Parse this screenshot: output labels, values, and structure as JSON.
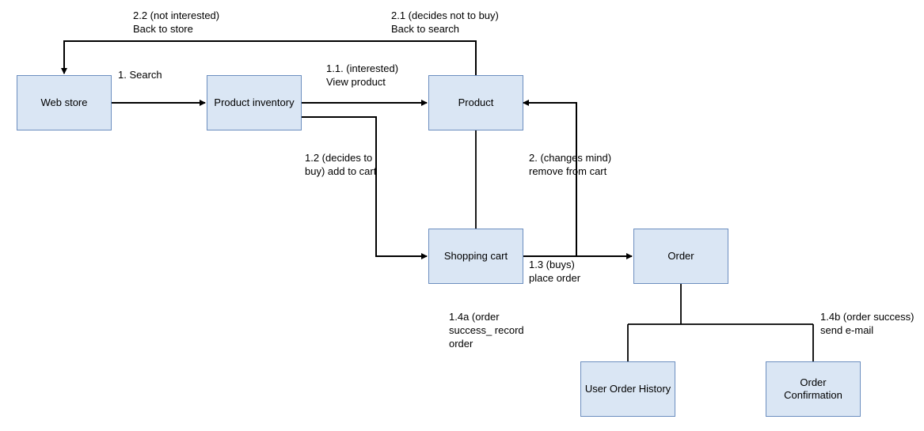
{
  "nodes": {
    "web_store": {
      "label": "Web store"
    },
    "product_inventory": {
      "label": "Product\ninventory"
    },
    "product": {
      "label": "Product"
    },
    "shopping_cart": {
      "label": "Shopping cart"
    },
    "order": {
      "label": "Order"
    },
    "user_order_history": {
      "label": "User Order\nHistory"
    },
    "order_confirmation": {
      "label": "Order\nConfirmation"
    }
  },
  "edges": {
    "search": {
      "label": "1. Search"
    },
    "view_product": {
      "label": "1.1. (interested)\nView product"
    },
    "add_to_cart": {
      "label": "1.2 (decides to\nbuy) add to cart"
    },
    "place_order": {
      "label": "1.3 (buys)\nplace order"
    },
    "record_order": {
      "label": "1.4a (order\nsuccess_ record\norder"
    },
    "send_email": {
      "label": "1.4b (order success)\nsend e-mail"
    },
    "remove_cart": {
      "label": "2. (changes mind)\nremove from cart"
    },
    "back_to_search": {
      "label": "2.1 (decides not to buy)\nBack to search"
    },
    "back_to_store": {
      "label": "2.2 (not interested)\nBack to store"
    }
  },
  "chart_data": {
    "type": "flowchart",
    "nodes": [
      {
        "id": "web_store",
        "label": "Web store"
      },
      {
        "id": "product_inventory",
        "label": "Product inventory"
      },
      {
        "id": "product",
        "label": "Product"
      },
      {
        "id": "shopping_cart",
        "label": "Shopping cart"
      },
      {
        "id": "order",
        "label": "Order"
      },
      {
        "id": "user_order_history",
        "label": "User Order History"
      },
      {
        "id": "order_confirmation",
        "label": "Order Confirmation"
      }
    ],
    "edges": [
      {
        "from": "web_store",
        "to": "product_inventory",
        "label": "1. Search"
      },
      {
        "from": "product_inventory",
        "to": "product",
        "label": "1.1. (interested) View product"
      },
      {
        "from": "product_inventory",
        "to": "shopping_cart",
        "label": "1.2 (decides to buy) add to cart"
      },
      {
        "from": "shopping_cart",
        "to": "order",
        "label": "1.3 (buys) place order"
      },
      {
        "from": "order",
        "to": "user_order_history",
        "label": "1.4a (order success_ record order"
      },
      {
        "from": "order",
        "to": "order_confirmation",
        "label": "1.4b (order success) send e-mail"
      },
      {
        "from": "shopping_cart",
        "to": "product",
        "label": "2. (changes mind) remove from cart"
      },
      {
        "from": "product",
        "to": "product_inventory",
        "label": "2.1 (decides not to buy) Back to search"
      },
      {
        "from": "product_inventory",
        "to": "web_store",
        "label": "2.2 (not interested) Back to store"
      }
    ]
  }
}
